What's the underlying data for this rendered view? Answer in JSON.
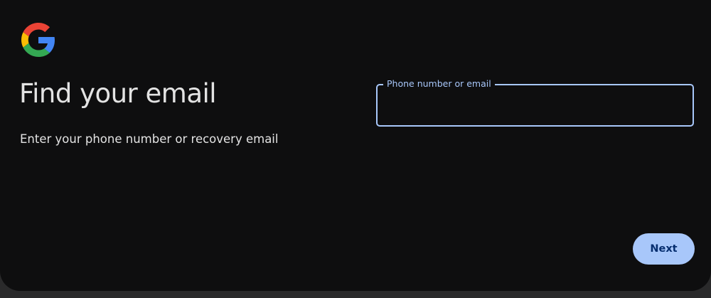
{
  "brand": {
    "logo_icon": "google-g-icon",
    "colors": {
      "blue": "#4285F4",
      "red": "#EA4335",
      "yellow": "#FBBC05",
      "green": "#34A853"
    }
  },
  "page": {
    "title": "Find your email",
    "subtitle": "Enter your phone number or recovery email"
  },
  "form": {
    "field_label": "Phone number or email",
    "field_value": "",
    "accent_color": "#a8c7fa"
  },
  "actions": {
    "next_label": "Next"
  },
  "theme": {
    "background": "#0e0e0f",
    "text": "#e3e3e3",
    "button_text": "#062e6f"
  }
}
